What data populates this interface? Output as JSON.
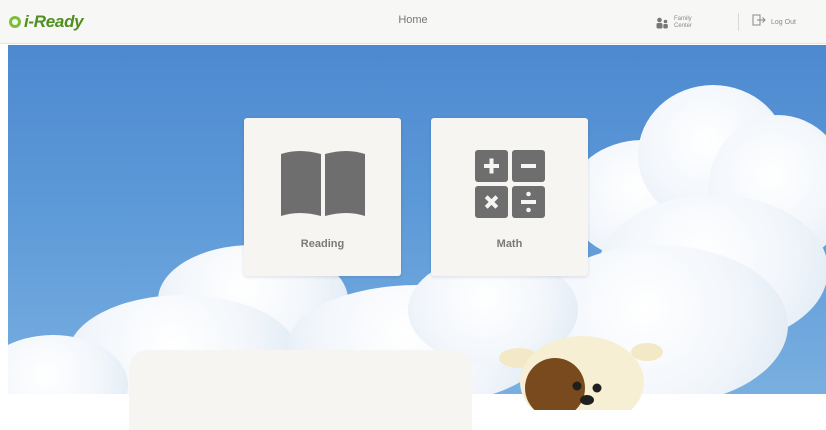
{
  "header": {
    "logo_text": "i-Ready",
    "page_title": "Home",
    "family_center_label": "Family Center",
    "logout_label": "Log Out"
  },
  "subjects": [
    {
      "label": "Reading",
      "icon": "open-book-icon"
    },
    {
      "label": "Math",
      "icon": "calculator-icon"
    }
  ],
  "colors": {
    "brand_green": "#4f8f1e",
    "sky_blue": "#5c99d8",
    "card_bg": "#f6f5f2",
    "icon_gray": "#6e6e6e"
  }
}
